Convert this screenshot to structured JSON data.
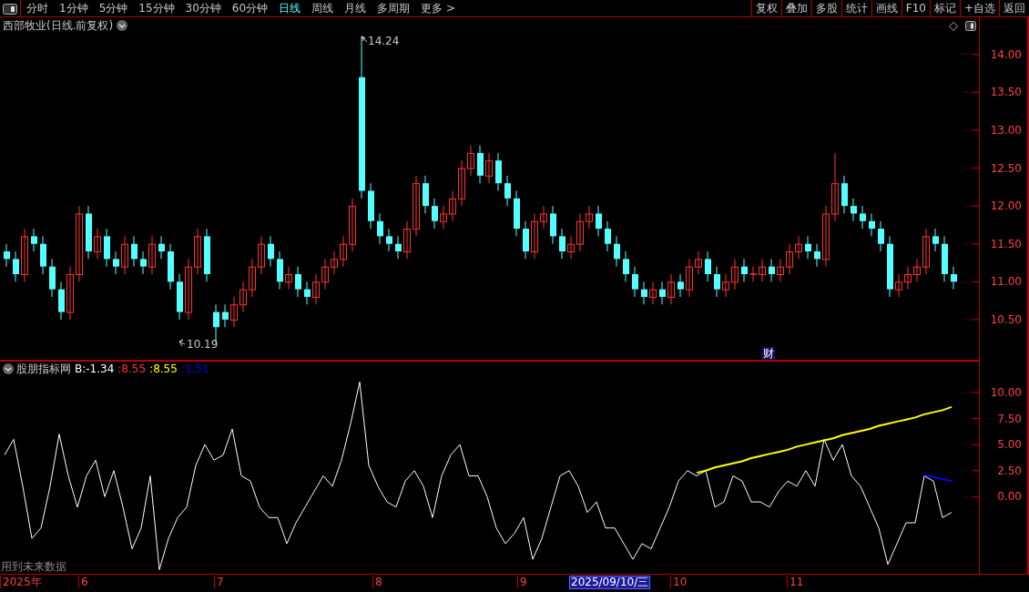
{
  "toolbar": {
    "periods": [
      {
        "label": "分时",
        "selected": false
      },
      {
        "label": "1分钟",
        "selected": false
      },
      {
        "label": "5分钟",
        "selected": false
      },
      {
        "label": "15分钟",
        "selected": false
      },
      {
        "label": "30分钟",
        "selected": false
      },
      {
        "label": "60分钟",
        "selected": false
      },
      {
        "label": "日线",
        "selected": true
      },
      {
        "label": "周线",
        "selected": false
      },
      {
        "label": "月线",
        "selected": false
      },
      {
        "label": "多周期",
        "selected": false
      }
    ],
    "more": "更多 >",
    "actions": [
      "复权",
      "叠加",
      "多股",
      "统计",
      "画线",
      "F10",
      "标记",
      "+自选",
      "返回"
    ]
  },
  "main_chart": {
    "title": "西部牧业(日线.前复权)",
    "high_marker": "14.24",
    "low_marker": "10.19",
    "event_badge": "财",
    "chart_data": {
      "type": "candlestick",
      "ylim": [
        9.97,
        14.49
      ],
      "yticks": [
        {
          "value": 14,
          "label": "14.00"
        },
        {
          "value": 13.5,
          "label": "13.50"
        },
        {
          "value": 13,
          "label": "13.00"
        },
        {
          "value": 12.5,
          "label": "12.50"
        },
        {
          "value": 12,
          "label": "12.00"
        },
        {
          "value": 11.5,
          "label": "11.50"
        },
        {
          "value": 11,
          "label": "11.00"
        },
        {
          "value": 10.5,
          "label": "10.50"
        }
      ],
      "ohlc": [
        [
          11.4,
          11.5,
          11.2,
          11.3
        ],
        [
          11.3,
          11.4,
          11.0,
          11.1
        ],
        [
          11.1,
          11.7,
          11.0,
          11.6
        ],
        [
          11.6,
          11.7,
          11.4,
          11.5
        ],
        [
          11.5,
          11.6,
          11.1,
          11.2
        ],
        [
          11.2,
          11.3,
          10.8,
          10.9
        ],
        [
          10.9,
          11.0,
          10.5,
          10.6
        ],
        [
          10.6,
          11.2,
          10.5,
          11.1
        ],
        [
          11.1,
          12.0,
          11.0,
          11.9
        ],
        [
          11.9,
          12.0,
          11.3,
          11.4
        ],
        [
          11.4,
          11.7,
          11.3,
          11.6
        ],
        [
          11.6,
          11.7,
          11.2,
          11.3
        ],
        [
          11.3,
          11.4,
          11.1,
          11.2
        ],
        [
          11.2,
          11.6,
          11.1,
          11.5
        ],
        [
          11.5,
          11.6,
          11.2,
          11.3
        ],
        [
          11.3,
          11.4,
          11.1,
          11.2
        ],
        [
          11.2,
          11.6,
          11.1,
          11.5
        ],
        [
          11.5,
          11.6,
          11.3,
          11.4
        ],
        [
          11.4,
          11.5,
          10.9,
          11.0
        ],
        [
          11.0,
          11.1,
          10.5,
          10.6
        ],
        [
          10.6,
          11.3,
          10.5,
          11.2
        ],
        [
          11.2,
          11.7,
          11.1,
          11.6
        ],
        [
          11.6,
          11.7,
          11.0,
          11.1
        ],
        [
          10.6,
          10.7,
          10.19,
          10.4
        ],
        [
          10.6,
          10.7,
          10.4,
          10.5
        ],
        [
          10.5,
          10.8,
          10.4,
          10.7
        ],
        [
          10.7,
          11.0,
          10.6,
          10.9
        ],
        [
          10.9,
          11.3,
          10.8,
          11.2
        ],
        [
          11.2,
          11.6,
          11.1,
          11.5
        ],
        [
          11.5,
          11.6,
          11.2,
          11.3
        ],
        [
          11.3,
          11.4,
          10.9,
          11.0
        ],
        [
          11.0,
          11.2,
          10.9,
          11.1
        ],
        [
          11.1,
          11.2,
          10.8,
          10.9
        ],
        [
          10.9,
          11.0,
          10.7,
          10.8
        ],
        [
          10.8,
          11.1,
          10.7,
          11.0
        ],
        [
          11.0,
          11.3,
          10.9,
          11.2
        ],
        [
          11.2,
          11.4,
          11.1,
          11.3
        ],
        [
          11.3,
          11.6,
          11.2,
          11.5
        ],
        [
          11.5,
          12.1,
          11.4,
          12.0
        ],
        [
          13.7,
          14.24,
          12.1,
          12.2
        ],
        [
          12.2,
          12.3,
          11.7,
          11.8
        ],
        [
          11.8,
          11.9,
          11.5,
          11.6
        ],
        [
          11.6,
          11.7,
          11.4,
          11.5
        ],
        [
          11.5,
          11.6,
          11.3,
          11.4
        ],
        [
          11.4,
          11.8,
          11.3,
          11.7
        ],
        [
          11.7,
          12.4,
          11.6,
          12.3
        ],
        [
          12.3,
          12.4,
          11.9,
          12.0
        ],
        [
          12.0,
          12.1,
          11.7,
          11.8
        ],
        [
          11.8,
          12.0,
          11.7,
          11.9
        ],
        [
          11.9,
          12.2,
          11.8,
          12.1
        ],
        [
          12.1,
          12.6,
          12.0,
          12.5
        ],
        [
          12.5,
          12.8,
          12.4,
          12.7
        ],
        [
          12.7,
          12.8,
          12.3,
          12.4
        ],
        [
          12.4,
          12.7,
          12.3,
          12.6
        ],
        [
          12.6,
          12.7,
          12.2,
          12.3
        ],
        [
          12.3,
          12.4,
          12.0,
          12.1
        ],
        [
          12.1,
          12.2,
          11.6,
          11.7
        ],
        [
          11.7,
          11.8,
          11.3,
          11.4
        ],
        [
          11.4,
          11.9,
          11.3,
          11.8
        ],
        [
          11.8,
          12.0,
          11.7,
          11.9
        ],
        [
          11.9,
          12.0,
          11.5,
          11.6
        ],
        [
          11.6,
          11.7,
          11.3,
          11.4
        ],
        [
          11.4,
          11.6,
          11.3,
          11.5
        ],
        [
          11.5,
          11.9,
          11.4,
          11.8
        ],
        [
          11.8,
          12.0,
          11.7,
          11.9
        ],
        [
          11.9,
          12.0,
          11.6,
          11.7
        ],
        [
          11.7,
          11.8,
          11.4,
          11.5
        ],
        [
          11.5,
          11.6,
          11.2,
          11.3
        ],
        [
          11.3,
          11.4,
          11.0,
          11.1
        ],
        [
          11.1,
          11.2,
          10.8,
          10.9
        ],
        [
          10.9,
          11.0,
          10.7,
          10.8
        ],
        [
          10.8,
          11.0,
          10.7,
          10.9
        ],
        [
          10.9,
          11.0,
          10.7,
          10.8
        ],
        [
          10.8,
          11.1,
          10.7,
          11.0
        ],
        [
          11.0,
          11.1,
          10.8,
          10.9
        ],
        [
          10.9,
          11.3,
          10.8,
          11.2
        ],
        [
          11.2,
          11.4,
          11.1,
          11.3
        ],
        [
          11.3,
          11.4,
          11.0,
          11.1
        ],
        [
          11.1,
          11.2,
          10.8,
          10.9
        ],
        [
          10.9,
          11.1,
          10.8,
          11.0
        ],
        [
          11.0,
          11.3,
          10.9,
          11.2
        ],
        [
          11.2,
          11.3,
          11.0,
          11.1
        ],
        [
          11.1,
          11.2,
          11.0,
          11.1
        ],
        [
          11.1,
          11.3,
          11.0,
          11.2
        ],
        [
          11.2,
          11.3,
          11.0,
          11.1
        ],
        [
          11.1,
          11.3,
          11.0,
          11.2
        ],
        [
          11.2,
          11.5,
          11.1,
          11.4
        ],
        [
          11.4,
          11.6,
          11.3,
          11.5
        ],
        [
          11.5,
          11.6,
          11.3,
          11.4
        ],
        [
          11.4,
          11.5,
          11.2,
          11.3
        ],
        [
          11.3,
          12.0,
          11.2,
          11.9
        ],
        [
          11.9,
          12.7,
          11.8,
          12.3
        ],
        [
          12.3,
          12.4,
          11.9,
          12.0
        ],
        [
          12.0,
          12.1,
          11.8,
          11.9
        ],
        [
          11.9,
          12.0,
          11.7,
          11.8
        ],
        [
          11.8,
          11.9,
          11.6,
          11.7
        ],
        [
          11.7,
          11.8,
          11.4,
          11.5
        ],
        [
          11.5,
          11.6,
          10.8,
          10.9
        ],
        [
          10.9,
          11.1,
          10.8,
          11.0
        ],
        [
          11.0,
          11.2,
          10.9,
          11.1
        ],
        [
          11.1,
          11.3,
          11.0,
          11.2
        ],
        [
          11.2,
          11.7,
          11.1,
          11.6
        ],
        [
          11.6,
          11.7,
          11.4,
          11.5
        ],
        [
          11.5,
          11.6,
          11.0,
          11.1
        ],
        [
          11.1,
          11.2,
          10.9,
          11.0
        ]
      ]
    }
  },
  "indicator": {
    "name": "股朋指标网",
    "values": [
      {
        "text": "B:-1.34",
        "color": "#ffffff"
      },
      {
        "text": ":8.55",
        "color": "#ff3232"
      },
      {
        "text": ":8.55",
        "color": "#ffff00"
      },
      {
        "text": ":1.51",
        "color": "#0000ff"
      }
    ],
    "note": "用到未来数据",
    "chart_data": {
      "type": "line",
      "ylim": [
        -7.39,
        12.96
      ],
      "yticks": [
        {
          "value": 10,
          "label": "10.00"
        },
        {
          "value": 7.5,
          "label": "7.50"
        },
        {
          "value": 5,
          "label": "5.00"
        },
        {
          "value": 2.5,
          "label": "2.50"
        },
        {
          "value": 0,
          "label": "0.00"
        }
      ],
      "series": [
        {
          "color": "#ffffff",
          "values": [
            4,
            5.5,
            1,
            -4,
            -3,
            1,
            6,
            2,
            -1,
            2,
            3.5,
            0,
            2.5,
            -1,
            -5,
            -3,
            2,
            -7,
            -4,
            -2,
            -1,
            3,
            5,
            3.5,
            4,
            6.5,
            2,
            1.5,
            -1,
            -2,
            -2,
            -4.5,
            -2.5,
            -1,
            0.5,
            2,
            1,
            3.5,
            7,
            11,
            3,
            1,
            -0.5,
            -1,
            1.5,
            2.5,
            1,
            -2,
            2,
            4,
            5,
            2,
            2,
            0,
            -3,
            -4.5,
            -3.5,
            -2,
            -6,
            -4,
            -1,
            2,
            2.5,
            1,
            -1.5,
            -0.5,
            -3,
            -3,
            -4.5,
            -6,
            -4.5,
            -5,
            -3,
            -1,
            1.5,
            2.5,
            2,
            2.5,
            -1,
            -0.5,
            2,
            1.5,
            -0.5,
            -0.5,
            -1,
            0.5,
            1.5,
            1,
            2.5,
            1,
            5.5,
            3.5,
            5,
            2,
            1,
            -1,
            -3,
            -6.5,
            -4.5,
            -2.5,
            -2.5,
            2,
            1.5,
            -2,
            -1.5
          ]
        },
        {
          "color": "#ffff00",
          "values": [
            null,
            null,
            null,
            null,
            null,
            null,
            null,
            null,
            null,
            null,
            null,
            null,
            null,
            null,
            null,
            null,
            null,
            null,
            null,
            null,
            null,
            null,
            null,
            null,
            null,
            null,
            null,
            null,
            null,
            null,
            null,
            null,
            null,
            null,
            null,
            null,
            null,
            null,
            null,
            null,
            null,
            null,
            null,
            null,
            null,
            null,
            null,
            null,
            null,
            null,
            null,
            null,
            null,
            null,
            null,
            null,
            null,
            null,
            null,
            null,
            null,
            null,
            null,
            null,
            null,
            null,
            null,
            null,
            null,
            null,
            null,
            null,
            null,
            null,
            null,
            null,
            2.3,
            2.5,
            2.8,
            3,
            3.2,
            3.4,
            3.7,
            3.9,
            4.1,
            4.3,
            4.5,
            4.8,
            5,
            5.2,
            5.4,
            5.6,
            5.9,
            6.1,
            6.3,
            6.5,
            6.8,
            7,
            7.2,
            7.4,
            7.6,
            7.9,
            8.1,
            8.3,
            8.6
          ]
        },
        {
          "color": "#0000ff",
          "values": [
            null,
            null,
            null,
            null,
            null,
            null,
            null,
            null,
            null,
            null,
            null,
            null,
            null,
            null,
            null,
            null,
            null,
            null,
            null,
            null,
            null,
            null,
            null,
            null,
            null,
            null,
            null,
            null,
            null,
            null,
            null,
            null,
            null,
            null,
            null,
            null,
            null,
            null,
            null,
            null,
            null,
            null,
            null,
            null,
            null,
            null,
            null,
            null,
            null,
            null,
            null,
            null,
            null,
            null,
            null,
            null,
            null,
            null,
            null,
            null,
            null,
            null,
            null,
            null,
            null,
            null,
            null,
            null,
            null,
            null,
            null,
            null,
            null,
            null,
            null,
            null,
            null,
            null,
            null,
            null,
            null,
            null,
            null,
            null,
            null,
            null,
            null,
            null,
            null,
            null,
            null,
            null,
            null,
            null,
            null,
            null,
            null,
            null,
            null,
            null,
            null,
            2.1,
            1.9,
            1.7,
            1.5
          ]
        }
      ]
    }
  },
  "date_axis": {
    "labels": [
      "2025年",
      "6",
      "7",
      "8",
      "9",
      "10",
      "11"
    ],
    "cursor_date": "2025/09/10/三"
  }
}
